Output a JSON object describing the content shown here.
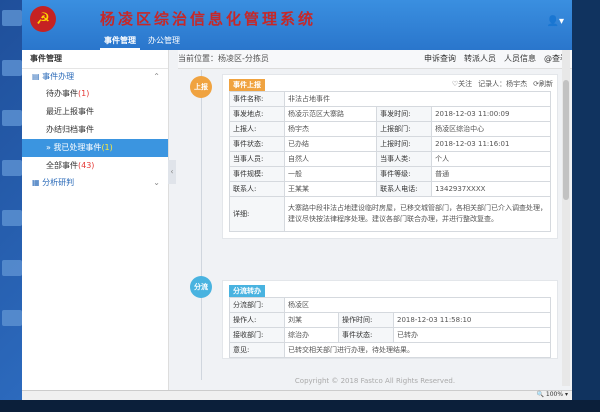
{
  "app": {
    "title": "杨凌区综治信息化管理系统",
    "nav_tabs": [
      "事件管理",
      "办公管理"
    ],
    "user_icon": "user-icon"
  },
  "sidebar": {
    "heading": "事件管理",
    "group": "事件办理",
    "group2": "分析研判",
    "items": [
      {
        "label": "待办事件",
        "count": "(1)"
      },
      {
        "label": "最近上报事件",
        "count": ""
      },
      {
        "label": "办结归档事件",
        "count": ""
      },
      {
        "label": "» 我已处理事件",
        "count": "(1)"
      },
      {
        "label": "全部事件",
        "count": "(43)"
      }
    ]
  },
  "breadcrumb": {
    "text": "当前位置：杨凌区-分拣员"
  },
  "toolbar": {
    "actions": [
      "申诉查询",
      "转派人员",
      "人员信息",
      "@查看"
    ],
    "follow": "关注",
    "recorder": "记录人：杨宇杰",
    "refresh": "刷新"
  },
  "timeline": [
    {
      "node": "上报",
      "badge": "事件上报",
      "rows": [
        [
          "事件名称:",
          "非法占地事件",
          "",
          ""
        ],
        [
          "事发地点:",
          "杨凌示范区大寨路",
          "事发时间:",
          "2018-12-03 11:00:09"
        ],
        [
          "上报人:",
          "杨宇杰",
          "上报部门:",
          "杨凌区综治中心"
        ],
        [
          "事件状态:",
          "已办结",
          "上报时间:",
          "2018-12-03 11:16:01"
        ],
        [
          "当事人员:",
          "自然人",
          "当事人类:",
          "个人"
        ],
        [
          "事件规模:",
          "一般",
          "事件等级:",
          "普通"
        ],
        [
          "联系人:",
          "王某某",
          "联系人电话:",
          "1342937XXXX"
        ]
      ],
      "detail_label": "详细:",
      "detail": "大寨路中段非法占地建设临时房屋，已移交城管部门，各相关部门已介入调查处理，建议尽快按法律程序处理。建议各部门联合办理，并进行整改复查。"
    },
    {
      "node": "分流",
      "badge": "分流转办",
      "rows": [
        [
          "分流部门:",
          "杨凌区",
          "",
          ""
        ],
        [
          "操作人:",
          "刘某",
          "操作时间:",
          "2018-12-03 11:58:10"
        ],
        [
          "接收部门:",
          "综治办",
          "事件状态:",
          "已转办"
        ]
      ],
      "detail_label": "意见:",
      "detail": "已转交相关部门进行办理，待处理结果。"
    }
  ],
  "footer": "Copyright © 2018 Fastco All Rights Reserved.",
  "status": {
    "zoom": "100%"
  },
  "colors": {
    "header": "#2a76cc",
    "active": "#3b95e0",
    "node1": "#f0a340",
    "node2": "#49b3e0",
    "title": "#c62828"
  }
}
